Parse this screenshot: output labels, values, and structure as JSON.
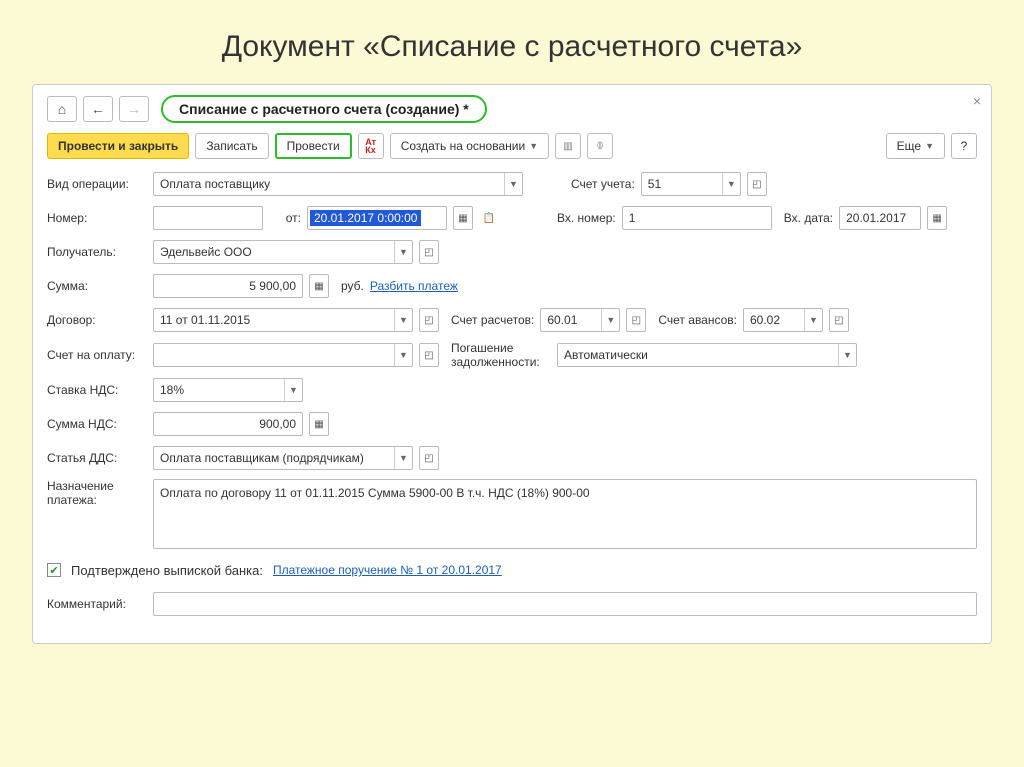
{
  "slide": {
    "title": "Документ «Списание с расчетного счета»"
  },
  "header": {
    "title": "Списание с расчетного счета (создание) *"
  },
  "toolbar": {
    "post_close": "Провести и закрыть",
    "save": "Записать",
    "post": "Провести",
    "create_based": "Создать на основании",
    "more": "Еще",
    "help": "?"
  },
  "labels": {
    "op_type": "Вид операции:",
    "number": "Номер:",
    "from": "от:",
    "account": "Счет учета:",
    "in_num": "Вх. номер:",
    "in_date": "Вх. дата:",
    "payee": "Получатель:",
    "sum": "Сумма:",
    "currency": "руб.",
    "split": "Разбить платеж",
    "contract": "Договор:",
    "acct_calc": "Счет расчетов:",
    "acct_adv": "Счет авансов:",
    "invoice": "Счет на оплату:",
    "debt": "Погашение задолженности:",
    "vat_rate": "Ставка НДС:",
    "vat_sum": "Сумма НДС:",
    "dds": "Статья ДДС:",
    "purpose": "Назначение платежа:",
    "confirmed": "Подтверждено выпиской банка:",
    "confirm_link": "Платежное поручение № 1 от 20.01.2017",
    "comment": "Комментарий:"
  },
  "values": {
    "op_type": "Оплата поставщику",
    "number": "",
    "date": "20.01.2017  0:00:00",
    "account": "51",
    "in_num": "1",
    "in_date": "20.01.2017",
    "payee": "Эдельвейс ООО",
    "sum": "5 900,00",
    "contract": "11 от 01.11.2015",
    "acct_calc": "60.01",
    "acct_adv": "60.02",
    "invoice": "",
    "debt": "Автоматически",
    "vat_rate": "18%",
    "vat_sum": "900,00",
    "dds": "Оплата поставщикам (подрядчикам)",
    "purpose": "Оплата по договору 11 от 01.11.2015 Сумма 5900-00 В т.ч. НДС  (18%) 900-00",
    "comment": ""
  }
}
